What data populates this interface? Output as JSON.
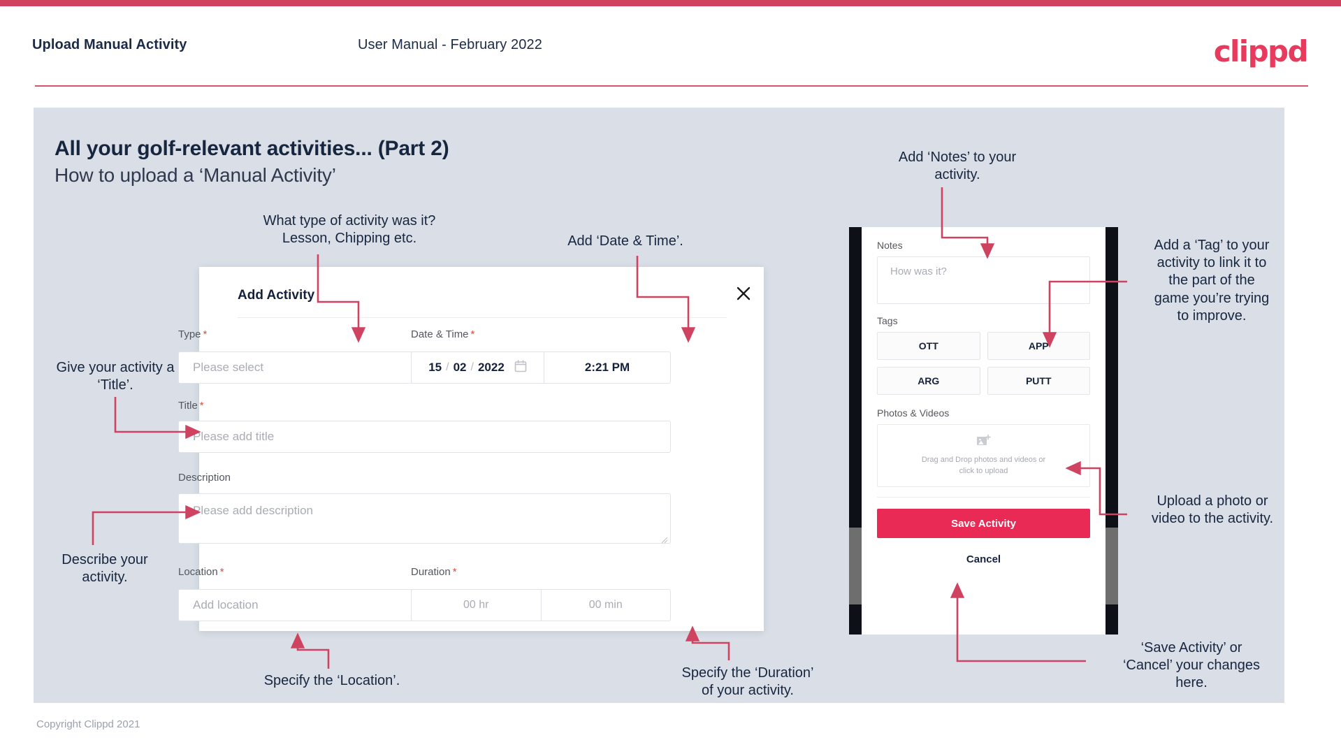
{
  "header": {
    "title": "Upload Manual Activity",
    "subtitle": "User Manual - February 2022",
    "logo": "clippd"
  },
  "slide": {
    "heading": "All your golf-relevant activities... (Part 2)",
    "subheading": "How to upload a ‘Manual Activity’",
    "footer": "Copyright Clippd 2021"
  },
  "dialog": {
    "title": "Add Activity",
    "close_icon": "close-icon",
    "fields": {
      "type": {
        "label": "Type",
        "required": "*",
        "placeholder": "Please select",
        "chevron": "chevron-down-icon"
      },
      "datetime": {
        "label": "Date & Time",
        "required": "*",
        "day": "15",
        "sep1": "/",
        "month": "02",
        "sep2": "/",
        "year": "2022",
        "calendar_icon": "calendar-icon",
        "time": "2:21 PM"
      },
      "title": {
        "label": "Title",
        "required": "*",
        "placeholder": "Please add title"
      },
      "description": {
        "label": "Description",
        "placeholder": "Please add description"
      },
      "location": {
        "label": "Location",
        "required": "*",
        "placeholder": "Add location"
      },
      "duration": {
        "label": "Duration",
        "required": "*",
        "hours": "00 hr",
        "minutes": "00 min"
      }
    }
  },
  "phone": {
    "notes": {
      "label": "Notes",
      "placeholder": "How was it?"
    },
    "tags": {
      "label": "Tags",
      "items": [
        "OTT",
        "APP",
        "ARG",
        "PUTT"
      ]
    },
    "photos": {
      "label": "Photos & Videos",
      "icon": "add-image-icon",
      "line1": "Drag and Drop photos and videos or",
      "line2": "click to upload"
    },
    "save_label": "Save Activity",
    "cancel_label": "Cancel"
  },
  "annotations": {
    "type": "What type of activity was it?\nLesson, Chipping etc.",
    "datetime": "Add ‘Date & Time’.",
    "title": "Give your activity a\n‘Title’.",
    "description": "Describe your\nactivity.",
    "location": "Specify the ‘Location’.",
    "duration": "Specify the ‘Duration’\nof your activity.",
    "notes": "Add ‘Notes’ to your\nactivity.",
    "tags": "Add a ‘Tag’ to your\nactivity to link it to\nthe part of the\ngame you’re trying\nto improve.",
    "upload": "Upload a photo or\nvideo to the activity.",
    "save": "‘Save Activity’ or\n‘Cancel’ your changes\nhere."
  },
  "colors": {
    "brand_pink": "#e83a5d",
    "accent_red": "#cf4360",
    "canvas": "#d9dee7",
    "ink": "#17263f",
    "save_button": "#e82a55"
  }
}
